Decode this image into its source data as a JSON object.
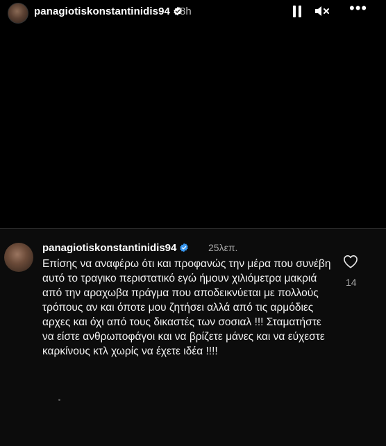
{
  "story": {
    "username": "panagiotiskonstantinidis94",
    "time": "8h"
  },
  "comment": {
    "username": "panagiotiskonstantinidis94",
    "time": "25λεπ.",
    "text": "Επίσης να αναφέρω ότι και προφανώς την μέρα που συνέβη αυτό το τραγικο περιστατικό εγώ ήμουν χιλιόμετρα μακριά από την αραχωβα πράγμα που αποδεικνύεται με πολλούς τρόπους αν και όποτε μου ζητήσει αλλά από τις αρμόδιες αρχες και όχι από τους δικαστές των σοσιαλ !!! Σταματήστε να είστε ανθρωποφάγοι και να βρίζετε μάνες και να εύχεστε καρκίνους κτλ χωρίς να έχετε ιδέα !!!!",
    "likes": "14"
  },
  "icons": {
    "verified": "verified-badge-icon",
    "pause": "pause-icon",
    "mute": "speaker-muted-icon",
    "more": "more-options-icon",
    "like": "heart-icon"
  },
  "colors": {
    "background": "#000000",
    "verified_blue": "#3897f0",
    "secondary_text": "#a8a8a8"
  }
}
